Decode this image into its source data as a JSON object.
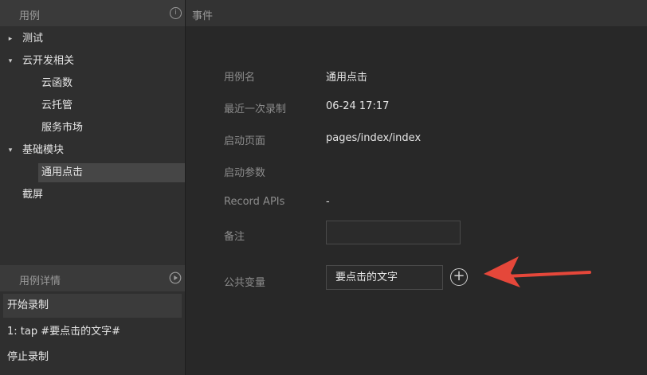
{
  "sidebar": {
    "header_title": "用例",
    "info_icon_glyph": "i",
    "tree": [
      {
        "label": "测试",
        "caret": "▸"
      },
      {
        "label": "云开发相关",
        "caret": "▾"
      },
      {
        "label": "云函数",
        "caret": ""
      },
      {
        "label": "云托管",
        "caret": ""
      },
      {
        "label": "服务市场",
        "caret": ""
      },
      {
        "label": "基础模块",
        "caret": "▾"
      },
      {
        "label": "通用点击",
        "caret": ""
      },
      {
        "label": "截屏",
        "caret": ""
      }
    ]
  },
  "details": {
    "header_title": "用例详情",
    "items": [
      {
        "label": "开始录制"
      },
      {
        "label": "1: tap #要点击的文字#"
      },
      {
        "label": "停止录制"
      }
    ]
  },
  "main": {
    "header_title": "事件",
    "fields": {
      "name_label": "用例名",
      "name_value": "通用点击",
      "last_record_label": "最近一次录制",
      "last_record_value": "06-24 17:17",
      "start_page_label": "启动页面",
      "start_page_value": "pages/index/index",
      "start_params_label": "启动参数",
      "record_apis_label": "Record APIs",
      "record_apis_value": "-",
      "note_label": "备注",
      "note_value": "",
      "public_var_label": "公共变量",
      "public_var_value": "要点击的文字",
      "add_glyph": "+"
    }
  },
  "colors": {
    "annotation_arrow": "#e5473a"
  }
}
